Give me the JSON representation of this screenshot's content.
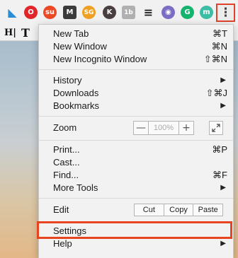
{
  "toolbar": {
    "extensions": [
      {
        "icon": "feather-icon",
        "glyph": "◣",
        "color": "#2a8bd6"
      },
      {
        "icon": "opera-icon",
        "glyph": "O",
        "color": "#e0262a"
      },
      {
        "icon": "stumbleupon-icon",
        "glyph": "su",
        "color": "#eb4924"
      },
      {
        "icon": "m-icon",
        "glyph": "M",
        "color": "#3b3b3b"
      },
      {
        "icon": "sg-icon",
        "glyph": "SG",
        "color": "#f0a020"
      },
      {
        "icon": "k-icon",
        "glyph": "K",
        "color": "#4a3f3f"
      },
      {
        "icon": "1b-icon",
        "glyph": "1b",
        "color": "#b0b0b0"
      },
      {
        "icon": "buffer-icon",
        "glyph": "≡",
        "color": "#222222"
      },
      {
        "icon": "circle-purple-icon",
        "glyph": "◉",
        "color": "#7b6cc4"
      },
      {
        "icon": "grammarly-icon",
        "glyph": "G",
        "color": "#14b46e"
      },
      {
        "icon": "m-teal-icon",
        "glyph": "m",
        "color": "#3dbda6"
      }
    ],
    "menu_icon": "⋮"
  },
  "bookmarks": [
    {
      "icon": "h-bookmark-icon",
      "glyph": "H|"
    },
    {
      "icon": "t-bookmark-icon",
      "glyph": "T"
    }
  ],
  "menu": {
    "new_tab": {
      "label": "New Tab",
      "shortcut": "⌘T"
    },
    "new_window": {
      "label": "New Window",
      "shortcut": "⌘N"
    },
    "new_incognito": {
      "label": "New Incognito Window",
      "shortcut": "⇧⌘N"
    },
    "history": {
      "label": "History"
    },
    "downloads": {
      "label": "Downloads",
      "shortcut": "⇧⌘J"
    },
    "bookmarks": {
      "label": "Bookmarks"
    },
    "zoom": {
      "label": "Zoom",
      "minus": "—",
      "value": "100%",
      "plus": "+"
    },
    "print": {
      "label": "Print...",
      "shortcut": "⌘P"
    },
    "cast": {
      "label": "Cast..."
    },
    "find": {
      "label": "Find...",
      "shortcut": "⌘F"
    },
    "more_tools": {
      "label": "More Tools"
    },
    "edit": {
      "label": "Edit",
      "cut": "Cut",
      "copy": "Copy",
      "paste": "Paste"
    },
    "settings": {
      "label": "Settings"
    },
    "help": {
      "label": "Help"
    },
    "arrow": "▶"
  },
  "colors": {
    "highlight": "#e64520"
  }
}
